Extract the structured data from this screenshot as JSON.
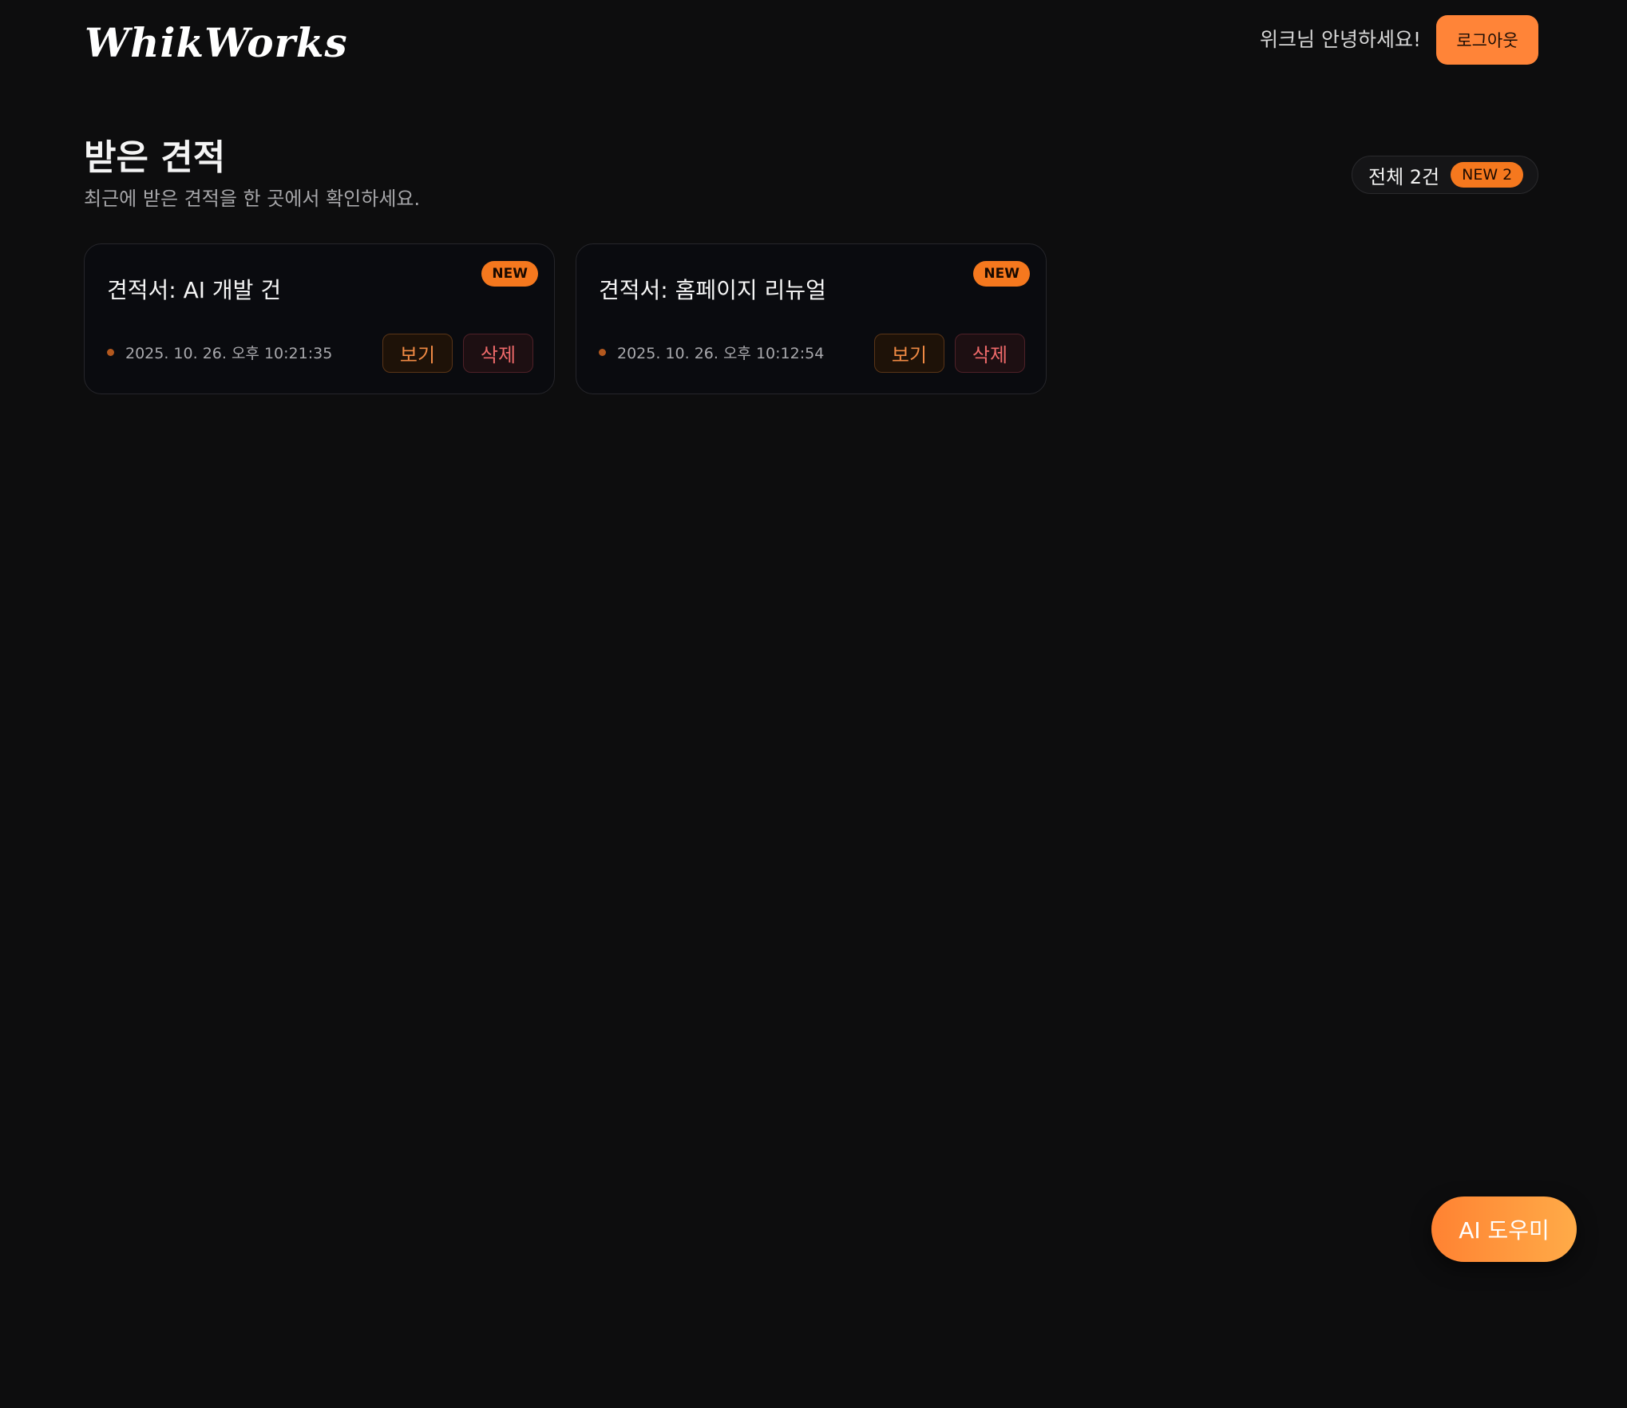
{
  "header": {
    "logo": "WhikWorks",
    "greeting": "위크님 안녕하세요!",
    "logout_label": "로그아웃"
  },
  "page": {
    "title": "받은 견적",
    "subtitle": "최근에 받은 견적을 한 곳에서 확인하세요.",
    "count_label": "전체 2건",
    "new_count_label": "NEW 2"
  },
  "quotes": [
    {
      "badge": "NEW",
      "title": "견적서: AI 개발 건",
      "date": "2025. 10. 26. 오후 10:21:35",
      "view_label": "보기",
      "delete_label": "삭제"
    },
    {
      "badge": "NEW",
      "title": "견적서: 홈페이지 리뉴얼",
      "date": "2025. 10. 26. 오후 10:12:54",
      "view_label": "보기",
      "delete_label": "삭제"
    }
  ],
  "ai_helper": {
    "label": "AI 도우미"
  },
  "colors": {
    "background": "#0d0d0e",
    "accent": "#ff8438",
    "new_badge": "#f5781e",
    "delete": "#ef6a6a"
  }
}
